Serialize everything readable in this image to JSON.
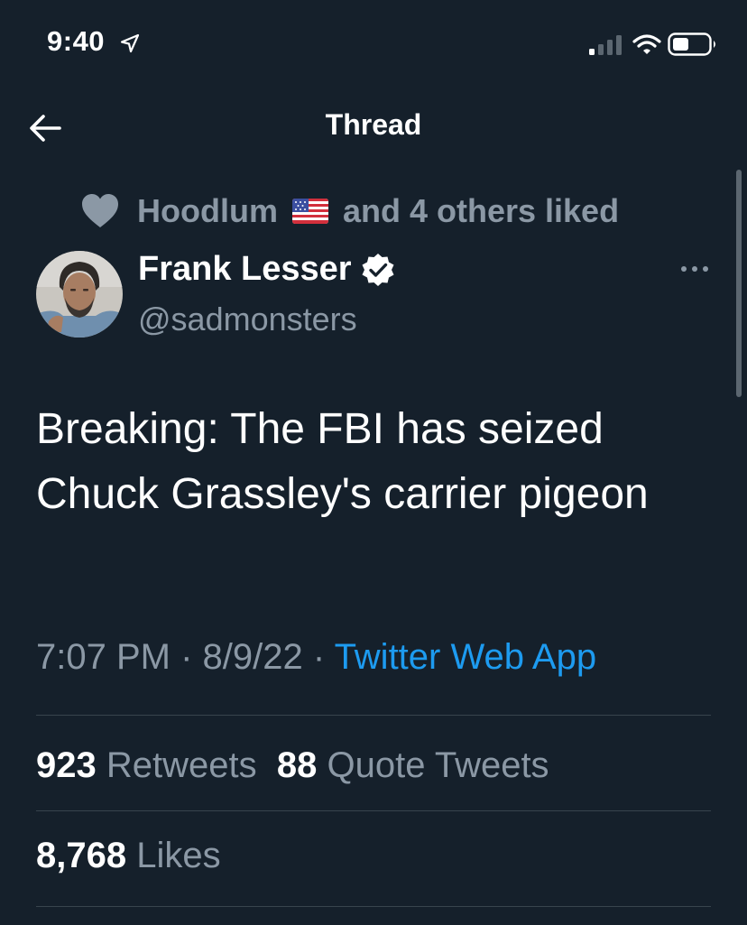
{
  "status_bar": {
    "time": "9:40"
  },
  "header": {
    "title": "Thread"
  },
  "social_context": {
    "liker": "Hoodlum",
    "rest": "and 4 others liked"
  },
  "author": {
    "name": "Frank Lesser",
    "handle": "@sadmonsters"
  },
  "tweet": {
    "text": "Breaking: The FBI has seized Chuck Grassley's carrier pigeon",
    "time": "7:07 PM",
    "date": "8/9/22",
    "separator": " · ",
    "source": "Twitter Web App"
  },
  "stats": {
    "retweets_count": "923",
    "retweets_label": "Retweets",
    "quotes_count": "88",
    "quotes_label": "Quote Tweets",
    "likes_count": "8,768",
    "likes_label": "Likes"
  },
  "colors": {
    "background": "#15202b",
    "secondary_text": "#8b98a5",
    "accent": "#1d9bf0",
    "divider": "#38444d"
  },
  "icons": [
    "location-arrow-icon",
    "signal-icon",
    "wifi-icon",
    "battery-icon",
    "back-arrow-icon",
    "heart-icon",
    "us-flag-icon",
    "verified-badge-icon",
    "more-options-icon"
  ]
}
